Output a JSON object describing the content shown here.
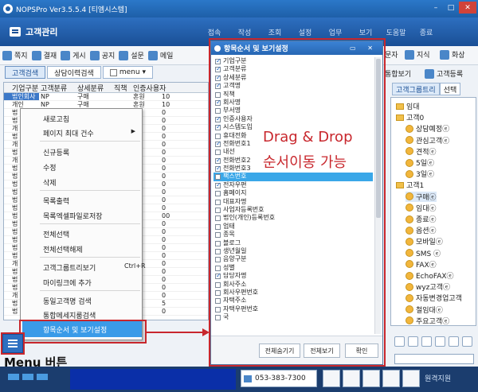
{
  "window": {
    "title": "NOPSPro Ver3.5.5.4 [티엠시스템]"
  },
  "header": {
    "module_title": "고객관리",
    "menus": [
      "접속",
      "작성",
      "조회",
      "설정",
      "업무",
      "보기",
      "도움말",
      "종료"
    ]
  },
  "toolbar": {
    "left_buttons": [
      "쪽지",
      "결재",
      "게시",
      "공지",
      "설문",
      "메일"
    ],
    "right_top": [
      "문자",
      "지식",
      "화상"
    ],
    "right_bottom": [
      "통합보기",
      "고객등록"
    ]
  },
  "left_tabs": {
    "tab1": "고객검색",
    "tab2": "상담이력검색",
    "tab3": "menu"
  },
  "grid": {
    "headers": [
      "기업구분",
      "고객분류",
      "상세분류",
      "직책",
      "인증사용자"
    ],
    "rows": [
      [
        "법인회사",
        "NP",
        "구매",
        "",
        "혼원",
        "10"
      ],
      [
        "개인",
        "NP",
        "구매",
        "",
        "혼원",
        "10"
      ],
      [
        "법",
        "",
        "",
        "",
        "",
        "0"
      ],
      [
        "법",
        "",
        "",
        "",
        "",
        "0"
      ],
      [
        "개",
        "",
        "",
        "",
        "",
        "0"
      ],
      [
        "법",
        "",
        "",
        "",
        "",
        "0"
      ],
      [
        "개",
        "",
        "",
        "",
        "",
        "0"
      ],
      [
        "법",
        "",
        "",
        "",
        "",
        "0"
      ],
      [
        "개",
        "",
        "",
        "",
        "",
        "0"
      ],
      [
        "법",
        "",
        "",
        "",
        "",
        "0"
      ],
      [
        "법",
        "",
        "",
        "",
        "",
        "0"
      ],
      [
        "법",
        "",
        "",
        "",
        "",
        "0"
      ],
      [
        "법",
        "",
        "",
        "",
        "",
        "0"
      ],
      [
        "법",
        "",
        "",
        "",
        "",
        "0"
      ],
      [
        "법",
        "",
        "",
        "",
        "",
        "0"
      ],
      [
        "법",
        "",
        "",
        "",
        "",
        "00"
      ],
      [
        "법",
        "",
        "",
        "",
        "",
        "0"
      ],
      [
        "법",
        "",
        "",
        "",
        "",
        "0"
      ],
      [
        "법",
        "",
        "",
        "",
        "",
        "0"
      ],
      [
        "법",
        "",
        "",
        "",
        "",
        "0"
      ],
      [
        "법",
        "",
        "",
        "",
        "",
        "0"
      ],
      [
        "개",
        "",
        "",
        "",
        "",
        "0"
      ],
      [
        "법",
        "",
        "",
        "",
        "",
        "0"
      ],
      [
        "법",
        "",
        "",
        "",
        "",
        "0"
      ],
      [
        "법",
        "",
        "",
        "",
        "",
        "0"
      ],
      [
        "개",
        "",
        "",
        "",
        "",
        "0"
      ],
      [
        "법",
        "",
        "",
        "",
        "",
        "5"
      ],
      [
        "법",
        "",
        "",
        "",
        "",
        "0"
      ]
    ]
  },
  "context_menu": {
    "items": [
      {
        "label": "새로고침"
      },
      {
        "label": "페이지 최대 건수",
        "submenu": true
      },
      {
        "label": "신규등록"
      },
      {
        "label": "수정"
      },
      {
        "label": "삭제"
      },
      {
        "label": "목록출력"
      },
      {
        "label": "목록엑셀파일로저장"
      },
      {
        "label": "전체선택"
      },
      {
        "label": "전체선택해제"
      },
      {
        "label": "고객그룹트리보기",
        "shortcut": "Ctrl+R"
      },
      {
        "label": "마이링크에 추가"
      },
      {
        "label": "동일고객명 검색"
      },
      {
        "label": "통합메세지룸검색"
      }
    ],
    "highlighted": "항목순서 및 보기설정"
  },
  "dialog": {
    "title": "항목순서 및 보기설정",
    "items": [
      {
        "label": "기업구분",
        "checked": true
      },
      {
        "label": "고객분류",
        "checked": true
      },
      {
        "label": "상세분류",
        "checked": true
      },
      {
        "label": "고객명",
        "checked": true
      },
      {
        "label": "직책",
        "checked": false
      },
      {
        "label": "회사명",
        "checked": true
      },
      {
        "label": "부서명",
        "checked": false
      },
      {
        "label": "인증사용자",
        "checked": true
      },
      {
        "label": "시스템도입",
        "checked": true
      },
      {
        "label": "휴대전화",
        "checked": false
      },
      {
        "label": "전화번호1",
        "checked": true
      },
      {
        "label": "내선",
        "checked": false
      },
      {
        "label": "전화번호2",
        "checked": true
      },
      {
        "label": "전화번호3",
        "checked": true
      },
      {
        "label": "팩스번호",
        "checked": false,
        "highlighted": true
      },
      {
        "label": "전자우편",
        "checked": true
      },
      {
        "label": "홈페이지",
        "checked": false
      },
      {
        "label": "대표자명",
        "checked": false
      },
      {
        "label": "사업자등록번호",
        "checked": false
      },
      {
        "label": "법인(개인)등록번호",
        "checked": false
      },
      {
        "label": "업태",
        "checked": false
      },
      {
        "label": "종목",
        "checked": false
      },
      {
        "label": "블로그",
        "checked": false
      },
      {
        "label": "생년월일",
        "checked": false
      },
      {
        "label": "음양구분",
        "checked": false
      },
      {
        "label": "성별",
        "checked": false
      },
      {
        "label": "담당자명",
        "checked": true
      },
      {
        "label": "회사주소",
        "checked": false
      },
      {
        "label": "회사우편번호",
        "checked": false
      },
      {
        "label": "자택주소",
        "checked": false
      },
      {
        "label": "자택우편번호",
        "checked": false
      },
      {
        "label": "국",
        "checked": false
      }
    ],
    "buttons": {
      "collapse_all": "전체숨기기",
      "show_all": "전체보기",
      "ok": "확인"
    }
  },
  "overlay": {
    "line1": "Drag & Drop",
    "line2": "순서이동 가능"
  },
  "right_tabs": {
    "tab1": "고객그룹트리",
    "tab2": "선택"
  },
  "tree": {
    "nodes": [
      {
        "label": "임대",
        "type": "folder",
        "indent": 0
      },
      {
        "label": "고객0",
        "type": "folder",
        "indent": 0
      },
      {
        "label": "상담예정ⓔ",
        "type": "item",
        "indent": 1
      },
      {
        "label": "관심고객ⓔ",
        "type": "item",
        "indent": 1
      },
      {
        "label": "견적ⓔ",
        "type": "item",
        "indent": 1
      },
      {
        "label": "5일ⓔ",
        "type": "item",
        "indent": 1
      },
      {
        "label": "3일ⓔ",
        "type": "item",
        "indent": 1
      },
      {
        "label": "고객1",
        "type": "folder",
        "indent": 0
      },
      {
        "label": "구매ⓔ",
        "type": "item",
        "indent": 1,
        "selected": true
      },
      {
        "label": "임대ⓔ",
        "type": "item",
        "indent": 1
      },
      {
        "label": "종료ⓔ",
        "type": "item",
        "indent": 1
      },
      {
        "label": "옵션ⓔ",
        "type": "item",
        "indent": 1
      },
      {
        "label": "모바일ⓔ",
        "type": "item",
        "indent": 1
      },
      {
        "label": "SMS ⓔ",
        "type": "item",
        "indent": 1
      },
      {
        "label": "FAXⓔ",
        "type": "item",
        "indent": 1
      },
      {
        "label": "EchoFAXⓔ",
        "type": "item",
        "indent": 1
      },
      {
        "label": "wyz고객ⓔ",
        "type": "item",
        "indent": 1
      },
      {
        "label": "자동변경업고객",
        "type": "item",
        "indent": 1
      },
      {
        "label": "철임대ⓔ",
        "type": "item",
        "indent": 1
      },
      {
        "label": "주요고객ⓔ",
        "type": "item",
        "indent": 1
      }
    ]
  },
  "bottom": {
    "menu_button_caption": "Menu 버튼",
    "phone": "053-383-7300",
    "remote": "원격지원"
  },
  "colors": {
    "accent": "#2d6fc0",
    "callout": "#c8272d",
    "highlight": "#3aa7e8"
  }
}
